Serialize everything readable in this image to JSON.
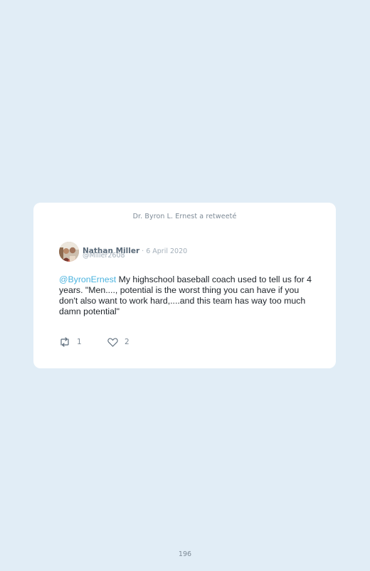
{
  "retweet_note": "Dr. Byron L. Ernest a retweeté",
  "tweet": {
    "author_name": "Nathan Miller",
    "separator": " · ",
    "date": "6 April 2020",
    "handle": "@Miller2608",
    "mention": "@ByronErnest",
    "text": " My highschool baseball coach used to tell us for 4 years. \"Men...., potential is the worst thing you can have if you don't also want to work hard,....and this team has way too much damn potential\"",
    "retweets": "1",
    "likes": "2"
  },
  "icons": {
    "retweet": "retweet-icon",
    "like": "heart-icon"
  },
  "colors": {
    "background": "#e1edf6",
    "card": "#ffffff",
    "mention": "#4ab3df"
  },
  "page_number": "196"
}
